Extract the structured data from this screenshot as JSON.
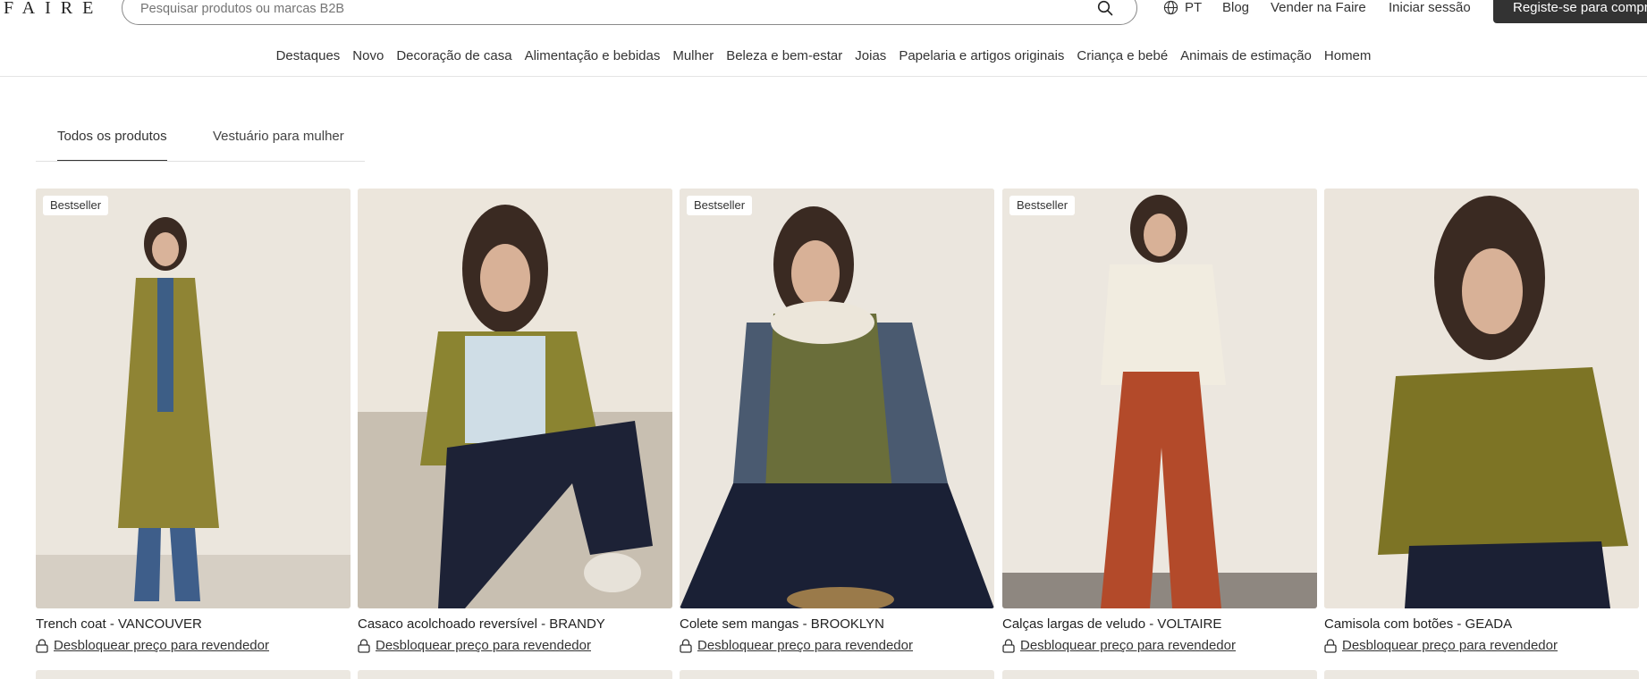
{
  "header": {
    "logo": "FAIRE",
    "search_placeholder": "Pesquisar produtos ou marcas B2B",
    "language": "PT",
    "blog": "Blog",
    "sell": "Vender na Faire",
    "login": "Iniciar sessão",
    "register": "Registe-se para comprar"
  },
  "categories": [
    "Destaques",
    "Novo",
    "Decoração de casa",
    "Alimentação e bebidas",
    "Mulher",
    "Beleza e bem-estar",
    "Joias",
    "Papelaria e artigos originais",
    "Criança e bebé",
    "Animais de estimação",
    "Homem"
  ],
  "tabs": {
    "all": "Todos os produtos",
    "womens_apparel": "Vestuário para mulher"
  },
  "products": [
    {
      "badge": "Bestseller",
      "name": "Trench coat - VANCOUVER",
      "price_cta": "Desbloquear preço para revendedor"
    },
    {
      "badge": "",
      "name": "Casaco acolchoado reversível - BRANDY",
      "price_cta": "Desbloquear preço para revendedor"
    },
    {
      "badge": "Bestseller",
      "name": "Colete sem mangas - BROOKLYN",
      "price_cta": "Desbloquear preço para revendedor"
    },
    {
      "badge": "Bestseller",
      "name": "Calças largas de veludo - VOLTAIRE",
      "price_cta": "Desbloquear preço para revendedor"
    },
    {
      "badge": "",
      "name": "Camisola com botões - GEADA",
      "price_cta": "Desbloquear preço para revendedor"
    }
  ],
  "colors": {
    "button_dark": "#333333",
    "text": "#333333",
    "photo_bg": "#ebe5dc"
  }
}
